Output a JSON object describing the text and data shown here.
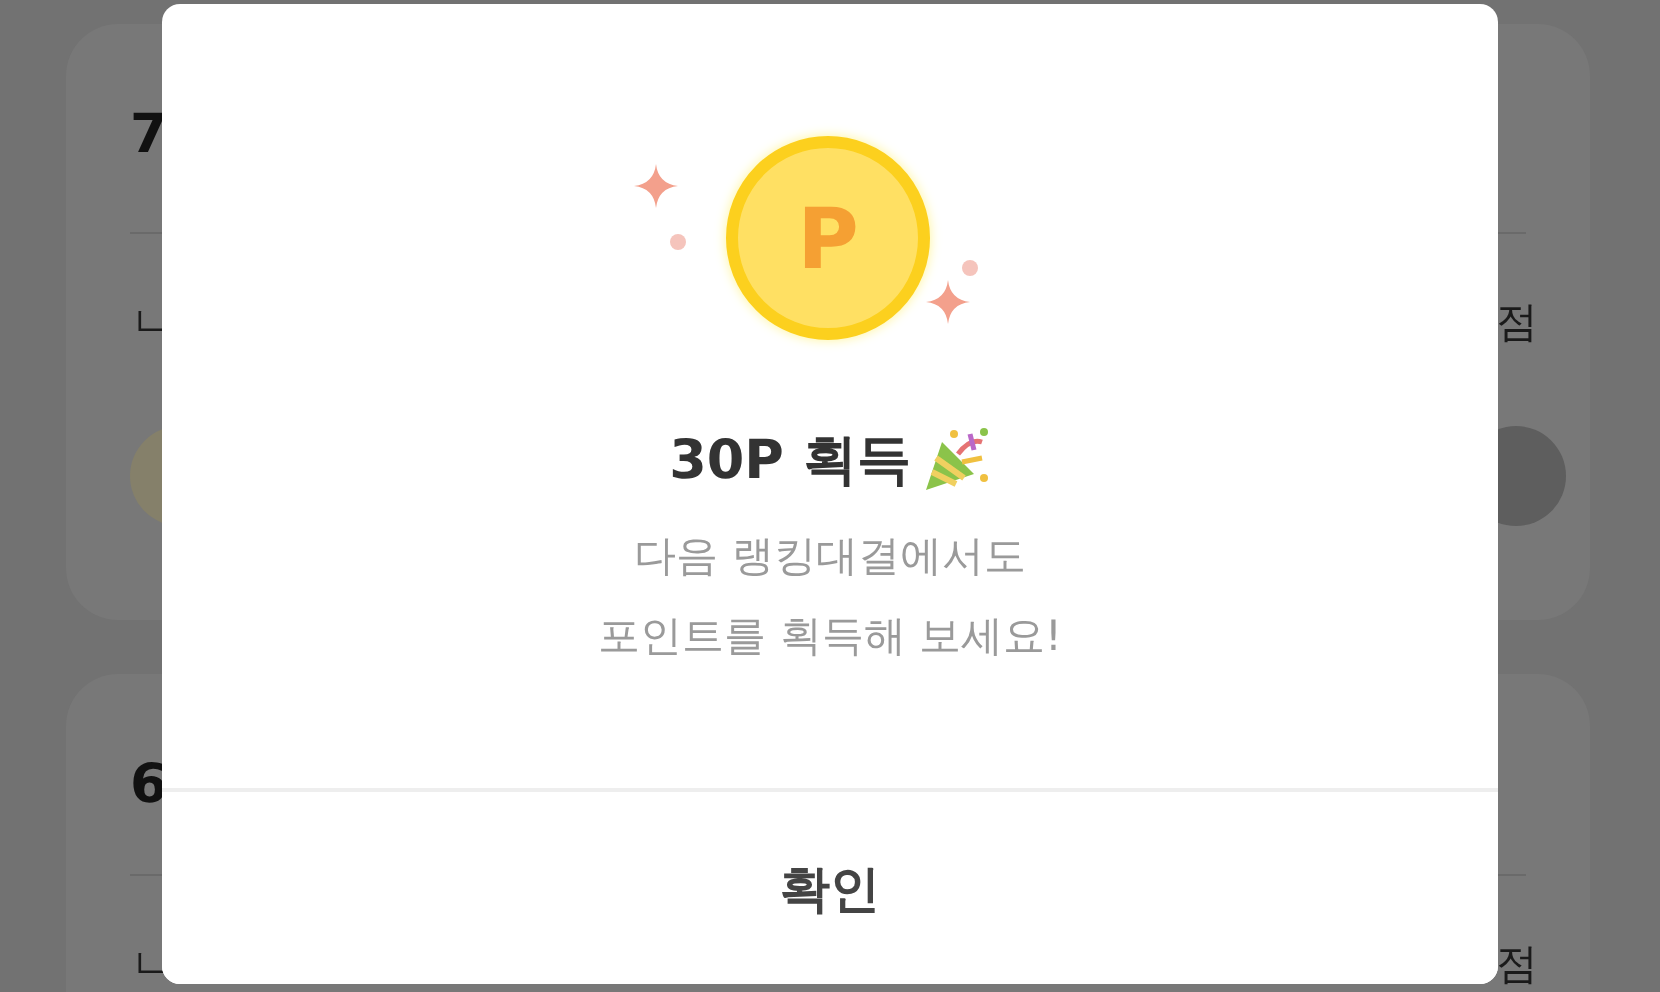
{
  "background": {
    "cards": [
      {
        "rank": "7",
        "left_text": "ㄴ",
        "right_text": "점"
      },
      {
        "rank": "6",
        "left_text": "ㄴ",
        "right_text": "점"
      }
    ]
  },
  "dialog": {
    "coin_letter": "P",
    "title": "30P 획득",
    "message_lines": [
      "다음 랭킹대결에서도",
      "포인트를 획득해 보세요!"
    ],
    "confirm_button": "확인"
  }
}
